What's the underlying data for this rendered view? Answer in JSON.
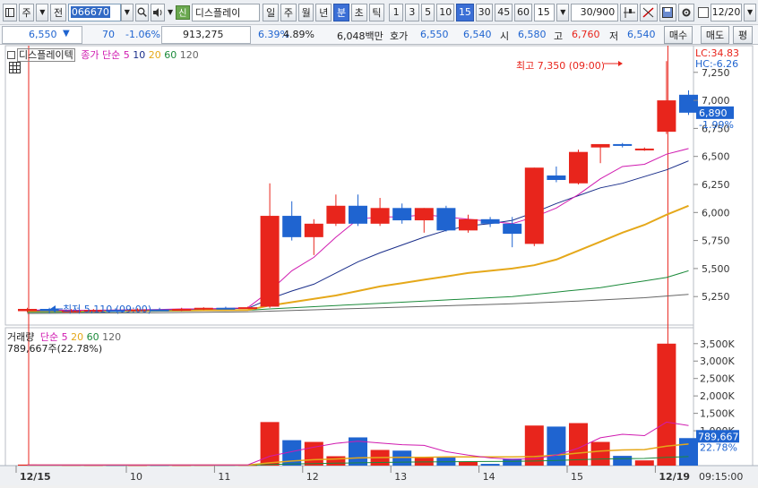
{
  "toolbar": {
    "type_label": "주",
    "prev_label": "전",
    "stock_code": "066670",
    "sin_badge": "신",
    "stock_name": "디스플레이",
    "period_day": "일",
    "period_week": "주",
    "period_month": "월",
    "period_year": "년",
    "period_min": "분",
    "period_sec": "초",
    "period_tick": "틱",
    "intervals": [
      "1",
      "3",
      "5",
      "10",
      "15",
      "30",
      "45",
      "60"
    ],
    "selected_interval": "15",
    "interval_value": "15",
    "count_value": "30/900",
    "date_value": "12/20"
  },
  "quote": {
    "price": "6,550",
    "direction": "▼",
    "change": "70",
    "change_pct": "-1.06%",
    "volume": "913,275",
    "turnover": "6.39%",
    "ratio": "4.89%",
    "amount": "6,048백만",
    "ask_label": "호가",
    "ask1": "6,550",
    "bid1": "6,540",
    "open_label": "시",
    "open": "6,580",
    "high_label": "고",
    "high": "6,760",
    "low_label": "저",
    "low": "6,540",
    "buy_label": "매수",
    "sell_label": "매도",
    "eval_label": "평"
  },
  "price_panel": {
    "title": "디스플레이텍",
    "ma_label": "종가 단순",
    "ma_periods": [
      "5",
      "10",
      "20",
      "60",
      "120"
    ],
    "lc_label": "LC:34.83",
    "hc_label": "HC:-6.26",
    "high_annotation": "최고 7,350 (09:00)",
    "low_annotation": "최저 5,110 (09:00)",
    "current_price_tag": "6,890",
    "current_pct_tag": "-1.99%",
    "y_ticks": [
      "7,250",
      "7,000",
      "6,750",
      "6,500",
      "6,250",
      "6,000",
      "5,750",
      "5,500",
      "5,250"
    ]
  },
  "volume_panel": {
    "title": "거래량",
    "ma_label": "단순",
    "ma_periods": [
      "5",
      "20",
      "60",
      "120"
    ],
    "current_label": "789,667주(22.78%)",
    "current_tag": "789,667",
    "current_pct_tag": "22.78%",
    "y_ticks": [
      "3,500K",
      "3,000K",
      "2,500K",
      "2,000K",
      "1,500K",
      "1,000K"
    ]
  },
  "x_axis": {
    "labels": [
      "12/15",
      "10",
      "11",
      "12",
      "13",
      "14",
      "15",
      "12/19"
    ],
    "time_label": "09:15:00"
  },
  "colors": {
    "up": "#e8251c",
    "down": "#1f64d0",
    "ma5": "#d01bb0",
    "ma10": "#1a2e8a",
    "ma20": "#e5a81a",
    "ma60": "#1b8a3a",
    "ma120": "#666666"
  },
  "chart_data": {
    "type": "candlestick",
    "price_axis": {
      "min": 5100,
      "max": 7400
    },
    "volume_axis": {
      "min": 0,
      "max": 3700000
    },
    "candles": [
      {
        "o": 5120,
        "h": 5150,
        "l": 5110,
        "c": 5140,
        "v": 30000
      },
      {
        "o": 5140,
        "h": 5150,
        "l": 5100,
        "c": 5120,
        "v": 25000
      },
      {
        "o": 5120,
        "h": 5140,
        "l": 5110,
        "c": 5125,
        "v": 20000
      },
      {
        "o": 5125,
        "h": 5140,
        "l": 5115,
        "c": 5130,
        "v": 18000
      },
      {
        "o": 5130,
        "h": 5145,
        "l": 5120,
        "c": 5125,
        "v": 15000
      },
      {
        "o": 5125,
        "h": 5145,
        "l": 5120,
        "c": 5135,
        "v": 15000
      },
      {
        "o": 5135,
        "h": 5150,
        "l": 5125,
        "c": 5130,
        "v": 15000
      },
      {
        "o": 5130,
        "h": 5150,
        "l": 5120,
        "c": 5140,
        "v": 15000
      },
      {
        "o": 5140,
        "h": 5155,
        "l": 5130,
        "c": 5150,
        "v": 20000
      },
      {
        "o": 5150,
        "h": 5160,
        "l": 5140,
        "c": 5145,
        "v": 20000
      },
      {
        "o": 5145,
        "h": 5160,
        "l": 5140,
        "c": 5155,
        "v": 20000
      },
      {
        "o": 5160,
        "h": 6260,
        "l": 5150,
        "c": 5970,
        "v": 1250000
      },
      {
        "o": 5970,
        "h": 6100,
        "l": 5750,
        "c": 5780,
        "v": 730000
      },
      {
        "o": 5780,
        "h": 5940,
        "l": 5620,
        "c": 5900,
        "v": 680000
      },
      {
        "o": 5900,
        "h": 6160,
        "l": 5880,
        "c": 6060,
        "v": 270000
      },
      {
        "o": 6060,
        "h": 6160,
        "l": 5880,
        "c": 5900,
        "v": 810000
      },
      {
        "o": 5900,
        "h": 6130,
        "l": 5880,
        "c": 6040,
        "v": 450000
      },
      {
        "o": 6040,
        "h": 6080,
        "l": 5900,
        "c": 5930,
        "v": 430000
      },
      {
        "o": 5930,
        "h": 6040,
        "l": 5820,
        "c": 6040,
        "v": 230000
      },
      {
        "o": 6040,
        "h": 6060,
        "l": 5830,
        "c": 5840,
        "v": 230000
      },
      {
        "o": 5840,
        "h": 5980,
        "l": 5820,
        "c": 5940,
        "v": 110000
      },
      {
        "o": 5940,
        "h": 5960,
        "l": 5870,
        "c": 5900,
        "v": 50000
      },
      {
        "o": 5900,
        "h": 5960,
        "l": 5690,
        "c": 5810,
        "v": 200000
      },
      {
        "o": 5720,
        "h": 6400,
        "l": 5700,
        "c": 6400,
        "v": 1150000
      },
      {
        "o": 6330,
        "h": 6410,
        "l": 6270,
        "c": 6290,
        "v": 1120000
      },
      {
        "o": 6260,
        "h": 6560,
        "l": 6250,
        "c": 6540,
        "v": 1220000
      },
      {
        "o": 6580,
        "h": 6600,
        "l": 6440,
        "c": 6610,
        "v": 680000
      },
      {
        "o": 6610,
        "h": 6620,
        "l": 6580,
        "c": 6600,
        "v": 280000
      },
      {
        "o": 6560,
        "h": 6580,
        "l": 6550,
        "c": 6570,
        "v": 150000
      },
      {
        "o": 6720,
        "h": 7350,
        "l": 6700,
        "c": 7000,
        "v": 3500000
      },
      {
        "o": 7050,
        "h": 7090,
        "l": 6870,
        "c": 6890,
        "v": 789667
      }
    ],
    "ma5": [
      5130,
      5130,
      5128,
      5128,
      5130,
      5132,
      5135,
      5140,
      5140,
      5145,
      5150,
      5300,
      5480,
      5600,
      5780,
      5940,
      5960,
      5960,
      5980,
      5960,
      5940,
      5920,
      5900,
      5960,
      6040,
      6160,
      6300,
      6410,
      6430,
      6520,
      6570
    ],
    "ma10": [
      5125,
      5126,
      5127,
      5128,
      5128,
      5130,
      5132,
      5135,
      5140,
      5142,
      5145,
      5230,
      5300,
      5360,
      5460,
      5560,
      5640,
      5710,
      5780,
      5840,
      5880,
      5900,
      5930,
      6000,
      6080,
      6150,
      6220,
      6260,
      6320,
      6380,
      6460
    ],
    "ma20": [
      5122,
      5122,
      5123,
      5124,
      5125,
      5125,
      5126,
      5127,
      5128,
      5129,
      5130,
      5170,
      5200,
      5230,
      5260,
      5300,
      5340,
      5370,
      5400,
      5430,
      5460,
      5480,
      5500,
      5530,
      5580,
      5660,
      5740,
      5820,
      5890,
      5980,
      6060
    ],
    "ma60": [
      5110,
      5110,
      5112,
      5114,
      5116,
      5118,
      5120,
      5122,
      5124,
      5126,
      5128,
      5140,
      5150,
      5160,
      5170,
      5180,
      5190,
      5200,
      5210,
      5220,
      5230,
      5240,
      5250,
      5270,
      5290,
      5310,
      5330,
      5360,
      5390,
      5420,
      5480
    ],
    "ma120": [
      5100,
      5101,
      5102,
      5103,
      5104,
      5105,
      5106,
      5108,
      5110,
      5112,
      5114,
      5120,
      5126,
      5132,
      5138,
      5144,
      5150,
      5156,
      5162,
      5168,
      5174,
      5180,
      5186,
      5194,
      5202,
      5210,
      5220,
      5230,
      5240,
      5255,
      5270
    ],
    "vma5": [
      20000,
      20000,
      20000,
      20000,
      20000,
      20000,
      20000,
      20000,
      20000,
      20000,
      20000,
      270000,
      400000,
      530000,
      640000,
      700000,
      650000,
      600000,
      580000,
      400000,
      300000,
      220000,
      180000,
      200000,
      300000,
      500000,
      800000,
      900000,
      860000,
      1250000,
      1150000
    ],
    "vma20": [
      15000,
      15000,
      15000,
      15000,
      15000,
      15000,
      15000,
      15000,
      15000,
      15000,
      15000,
      80000,
      130000,
      170000,
      190000,
      220000,
      230000,
      240000,
      240000,
      250000,
      250000,
      250000,
      250000,
      260000,
      300000,
      360000,
      420000,
      450000,
      460000,
      560000,
      620000
    ],
    "vma60": [
      10000,
      10000,
      10000,
      10000,
      10000,
      10000,
      10000,
      10000,
      10000,
      10000,
      10000,
      30000,
      50000,
      60000,
      70000,
      80000,
      90000,
      100000,
      105000,
      110000,
      115000,
      118000,
      120000,
      130000,
      150000,
      170000,
      190000,
      200000,
      205000,
      240000,
      260000
    ]
  }
}
